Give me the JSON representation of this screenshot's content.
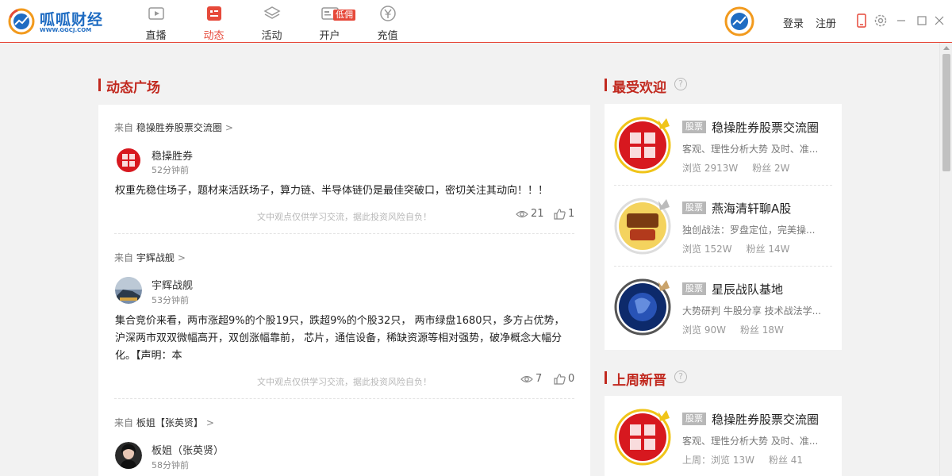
{
  "app": {
    "logo_text": "呱呱财经",
    "logo_url": "WWW.GGCJ.COM"
  },
  "nav": [
    {
      "label": "直播",
      "icon": "tv-icon",
      "active": false
    },
    {
      "label": "动态",
      "icon": "news-icon",
      "active": true
    },
    {
      "label": "活动",
      "icon": "layers-icon",
      "active": false
    },
    {
      "label": "开户",
      "icon": "account-icon",
      "active": false
    },
    {
      "label": "充值",
      "icon": "yen-coin-icon",
      "active": false
    }
  ],
  "nav_badge": "低佣",
  "header": {
    "login": "登录",
    "register": "注册"
  },
  "colors": {
    "accent": "#e6493a",
    "section_title": "#c1291f",
    "brand_blue": "#1f6cc2"
  },
  "feed": {
    "title": "动态广场",
    "from_prefix": "来自",
    "disclaimer": "文中观点仅供学习交流，据此投资风险自负！",
    "posts": [
      {
        "source": "稳操胜券股票交流圈",
        "author": "稳操胜券",
        "time": "52分钟前",
        "text": "权重先稳住场子，题材来活跃场子，算力链、半导体链仍是最佳突破口，密切关注其动向！！！",
        "views": "21",
        "likes": "1"
      },
      {
        "source": "宇辉战舰",
        "author": "宇辉战舰",
        "time": "53分钟前",
        "text": "集合竞价来看，两市涨超9%的个股19只，跌超9%的个股32只， 两市绿盘1680只，多方占优势，沪深两市双双微幅高开，双创涨幅靠前， 芯片，通信设备，稀缺资源等相对强势，破净概念大幅分化。【声明：本",
        "views": "7",
        "likes": "0"
      },
      {
        "source": "板姐【张英贤】",
        "author": "板姐（张英贤）",
        "time": "58分钟前"
      }
    ]
  },
  "popular": {
    "title": "最受欢迎",
    "items": [
      {
        "tag": "股票",
        "name": "稳操胜券股票交流圈",
        "desc": "客观、理性分析大势 及时、准...",
        "views": "浏览 2913W",
        "fans": "粉丝 2W"
      },
      {
        "tag": "股票",
        "name": "燕海清轩聊A股",
        "desc": "独创战法：罗盘定位，完美操...",
        "views": "浏览 152W",
        "fans": "粉丝 14W"
      },
      {
        "tag": "股票",
        "name": "星辰战队基地",
        "desc": "大势研判 牛股分享 技术战法学...",
        "views": "浏览 90W",
        "fans": "粉丝 18W"
      }
    ]
  },
  "new_week": {
    "title": "上周新晋",
    "items": [
      {
        "tag": "股票",
        "name": "稳操胜券股票交流圈",
        "desc": "客观、理性分析大势 及时、准...",
        "views": "上周：浏览 13W",
        "fans": "粉丝 41"
      }
    ]
  }
}
